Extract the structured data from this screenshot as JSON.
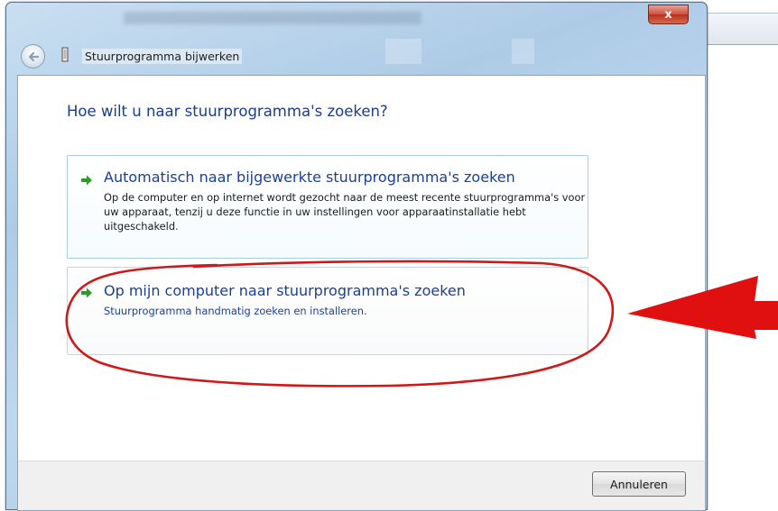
{
  "dialog": {
    "close_label": "x",
    "wizard_title": "Stuurprogramma bijwerken"
  },
  "content": {
    "question": "Hoe wilt u naar stuurprogramma's zoeken?",
    "options": [
      {
        "title": "Automatisch naar bijgewerkte stuurprogramma's zoeken",
        "description": "Op de computer en op internet wordt gezocht naar de meest recente stuurprogramma's voor uw apparaat, tenzij u deze functie in uw instellingen voor apparaatinstallatie hebt uitgeschakeld."
      },
      {
        "title": "Op mijn computer naar stuurprogramma's zoeken",
        "description": "Stuurprogramma handmatig zoeken en installeren."
      }
    ]
  },
  "footer": {
    "cancel_label": "Annuleren"
  },
  "icons": {
    "back": "back-arrow-icon",
    "device": "device-icon",
    "option_arrow": "green-arrow-icon"
  },
  "colors": {
    "heading_blue": "#1a3d8f",
    "option_arrow_green": "#2e9a2e",
    "annotation_red": "#e01010"
  }
}
